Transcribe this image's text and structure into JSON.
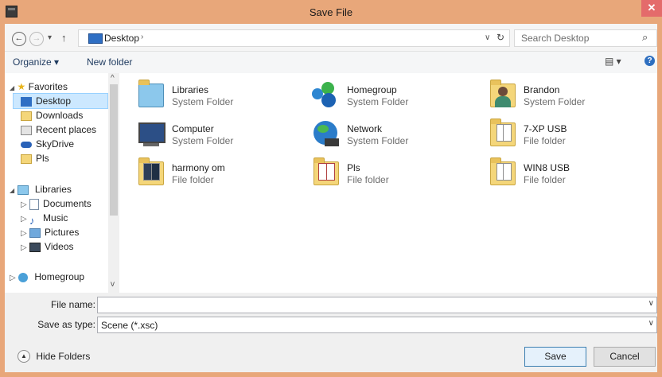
{
  "window": {
    "title": "Save File",
    "close_glyph": "✕"
  },
  "address": {
    "back_glyph": "←",
    "forward_glyph": "→",
    "recent_glyph": "▾",
    "up_glyph": "↑",
    "location": "Desktop",
    "crumb_sep": "›",
    "dropdown_glyph": "∨",
    "refresh_glyph": "↻",
    "search_placeholder": "Search Desktop",
    "search_glyph": "⌕"
  },
  "toolbar": {
    "organize": "Organize ▾",
    "new_folder": "New folder",
    "view_glyph": "▤ ▾",
    "help_glyph": "?"
  },
  "nav": {
    "favorites": "Favorites",
    "favorites_items": [
      "Desktop",
      "Downloads",
      "Recent places",
      "SkyDrive",
      "Pls"
    ],
    "libraries": "Libraries",
    "libraries_items": [
      "Documents",
      "Music",
      "Pictures",
      "Videos"
    ],
    "homegroup": "Homegroup",
    "expand_open": "◢",
    "expand_closed": "▷",
    "scroll_up": "^",
    "scroll_down": "v"
  },
  "items": [
    {
      "name": "Libraries",
      "type": "System Folder",
      "icon": "libraries-icon"
    },
    {
      "name": "Homegroup",
      "type": "System Folder",
      "icon": "homegroup-icon"
    },
    {
      "name": "Brandon",
      "type": "System Folder",
      "icon": "user-folder-icon"
    },
    {
      "name": "Computer",
      "type": "System Folder",
      "icon": "computer-icon"
    },
    {
      "name": "Network",
      "type": "System Folder",
      "icon": "network-icon"
    },
    {
      "name": "7-XP USB",
      "type": "File folder",
      "icon": "folder-icon"
    },
    {
      "name": "harmony om",
      "type": "File folder",
      "icon": "folder-icon"
    },
    {
      "name": "Pls",
      "type": "File folder",
      "icon": "folder-icon"
    },
    {
      "name": "WIN8 USB",
      "type": "File folder",
      "icon": "folder-icon"
    }
  ],
  "fields": {
    "file_name_label": "File name:",
    "file_name_value": "",
    "save_type_label": "Save as type:",
    "save_type_value": "Scene (*.xsc)",
    "dropdown_glyph": "∨"
  },
  "footer": {
    "hide_folders": "Hide Folders",
    "hide_glyph": "▲",
    "save": "Save",
    "cancel": "Cancel"
  },
  "colors": {
    "titlebar": "#e8a77a",
    "close": "#e46b6b",
    "selection": "#cce8ff"
  }
}
